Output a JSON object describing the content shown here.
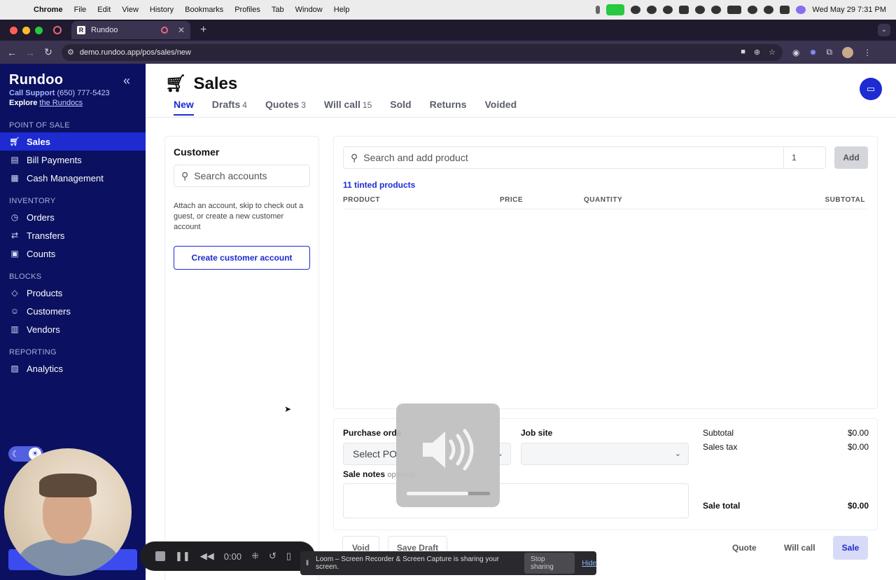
{
  "menubar": {
    "app": "Chrome",
    "items": [
      "File",
      "Edit",
      "View",
      "History",
      "Bookmarks",
      "Profiles",
      "Tab",
      "Window",
      "Help"
    ],
    "clock": "Wed May 29  7:31 PM"
  },
  "browser": {
    "tab_title": "Rundoo",
    "tab_favicon": "R",
    "url": "demo.rundoo.app/pos/sales/new"
  },
  "sidebar": {
    "brand": "Rundoo",
    "support_label": "Call Support",
    "support_phone": "(650) 777-5423",
    "explore_label": "Explore",
    "explore_link": "the Rundocs",
    "sections": {
      "pos": "POINT OF SALE",
      "inventory": "INVENTORY",
      "blocks": "BLOCKS",
      "reporting": "REPORTING"
    },
    "items": {
      "sales": "Sales",
      "bill_payments": "Bill Payments",
      "cash_management": "Cash Management",
      "orders": "Orders",
      "transfers": "Transfers",
      "counts": "Counts",
      "products": "Products",
      "customers": "Customers",
      "vendors": "Vendors",
      "analytics": "Analytics"
    }
  },
  "page": {
    "title": "Sales",
    "tabs": {
      "new": "New",
      "drafts": "Drafts",
      "drafts_count": "4",
      "quotes": "Quotes",
      "quotes_count": "3",
      "will_call": "Will call",
      "will_call_count": "15",
      "sold": "Sold",
      "returns": "Returns",
      "voided": "Voided"
    }
  },
  "customer": {
    "heading": "Customer",
    "search_placeholder": "Search accounts",
    "hint": "Attach an account, skip to check out a guest, or create a new customer account",
    "create_button": "Create customer account"
  },
  "products": {
    "search_placeholder": "Search and add product",
    "quantity": "1",
    "add_button": "Add",
    "tinted_link": "11 tinted products",
    "columns": {
      "product": "PRODUCT",
      "price": "PRICE",
      "quantity": "QUANTITY",
      "subtotal": "SUBTOTAL"
    }
  },
  "order": {
    "po_label": "Purchase orde",
    "po_placeholder": "Select PO",
    "job_site_label": "Job site",
    "notes_label": "Sale notes",
    "notes_optional": "optional",
    "subtotal_label": "Subtotal",
    "subtotal": "$0.00",
    "tax_label": "Sales tax",
    "tax": "$0.00",
    "total_label": "Sale total",
    "total": "$0.00"
  },
  "actions": {
    "void": "Void",
    "save_draft": "Save Draft",
    "quote": "Quote",
    "will_call": "Will call",
    "sale": "Sale"
  },
  "loom": {
    "timer": "0:00",
    "share_message": "Loom – Screen Recorder & Screen Capture is sharing your screen.",
    "stop_sharing": "Stop sharing",
    "hide": "Hide"
  },
  "volume_level": 0.74,
  "colors": {
    "sidebar_bg": "#0b1160",
    "accent": "#1d2bd1",
    "chrome_bg": "#3b3450"
  }
}
